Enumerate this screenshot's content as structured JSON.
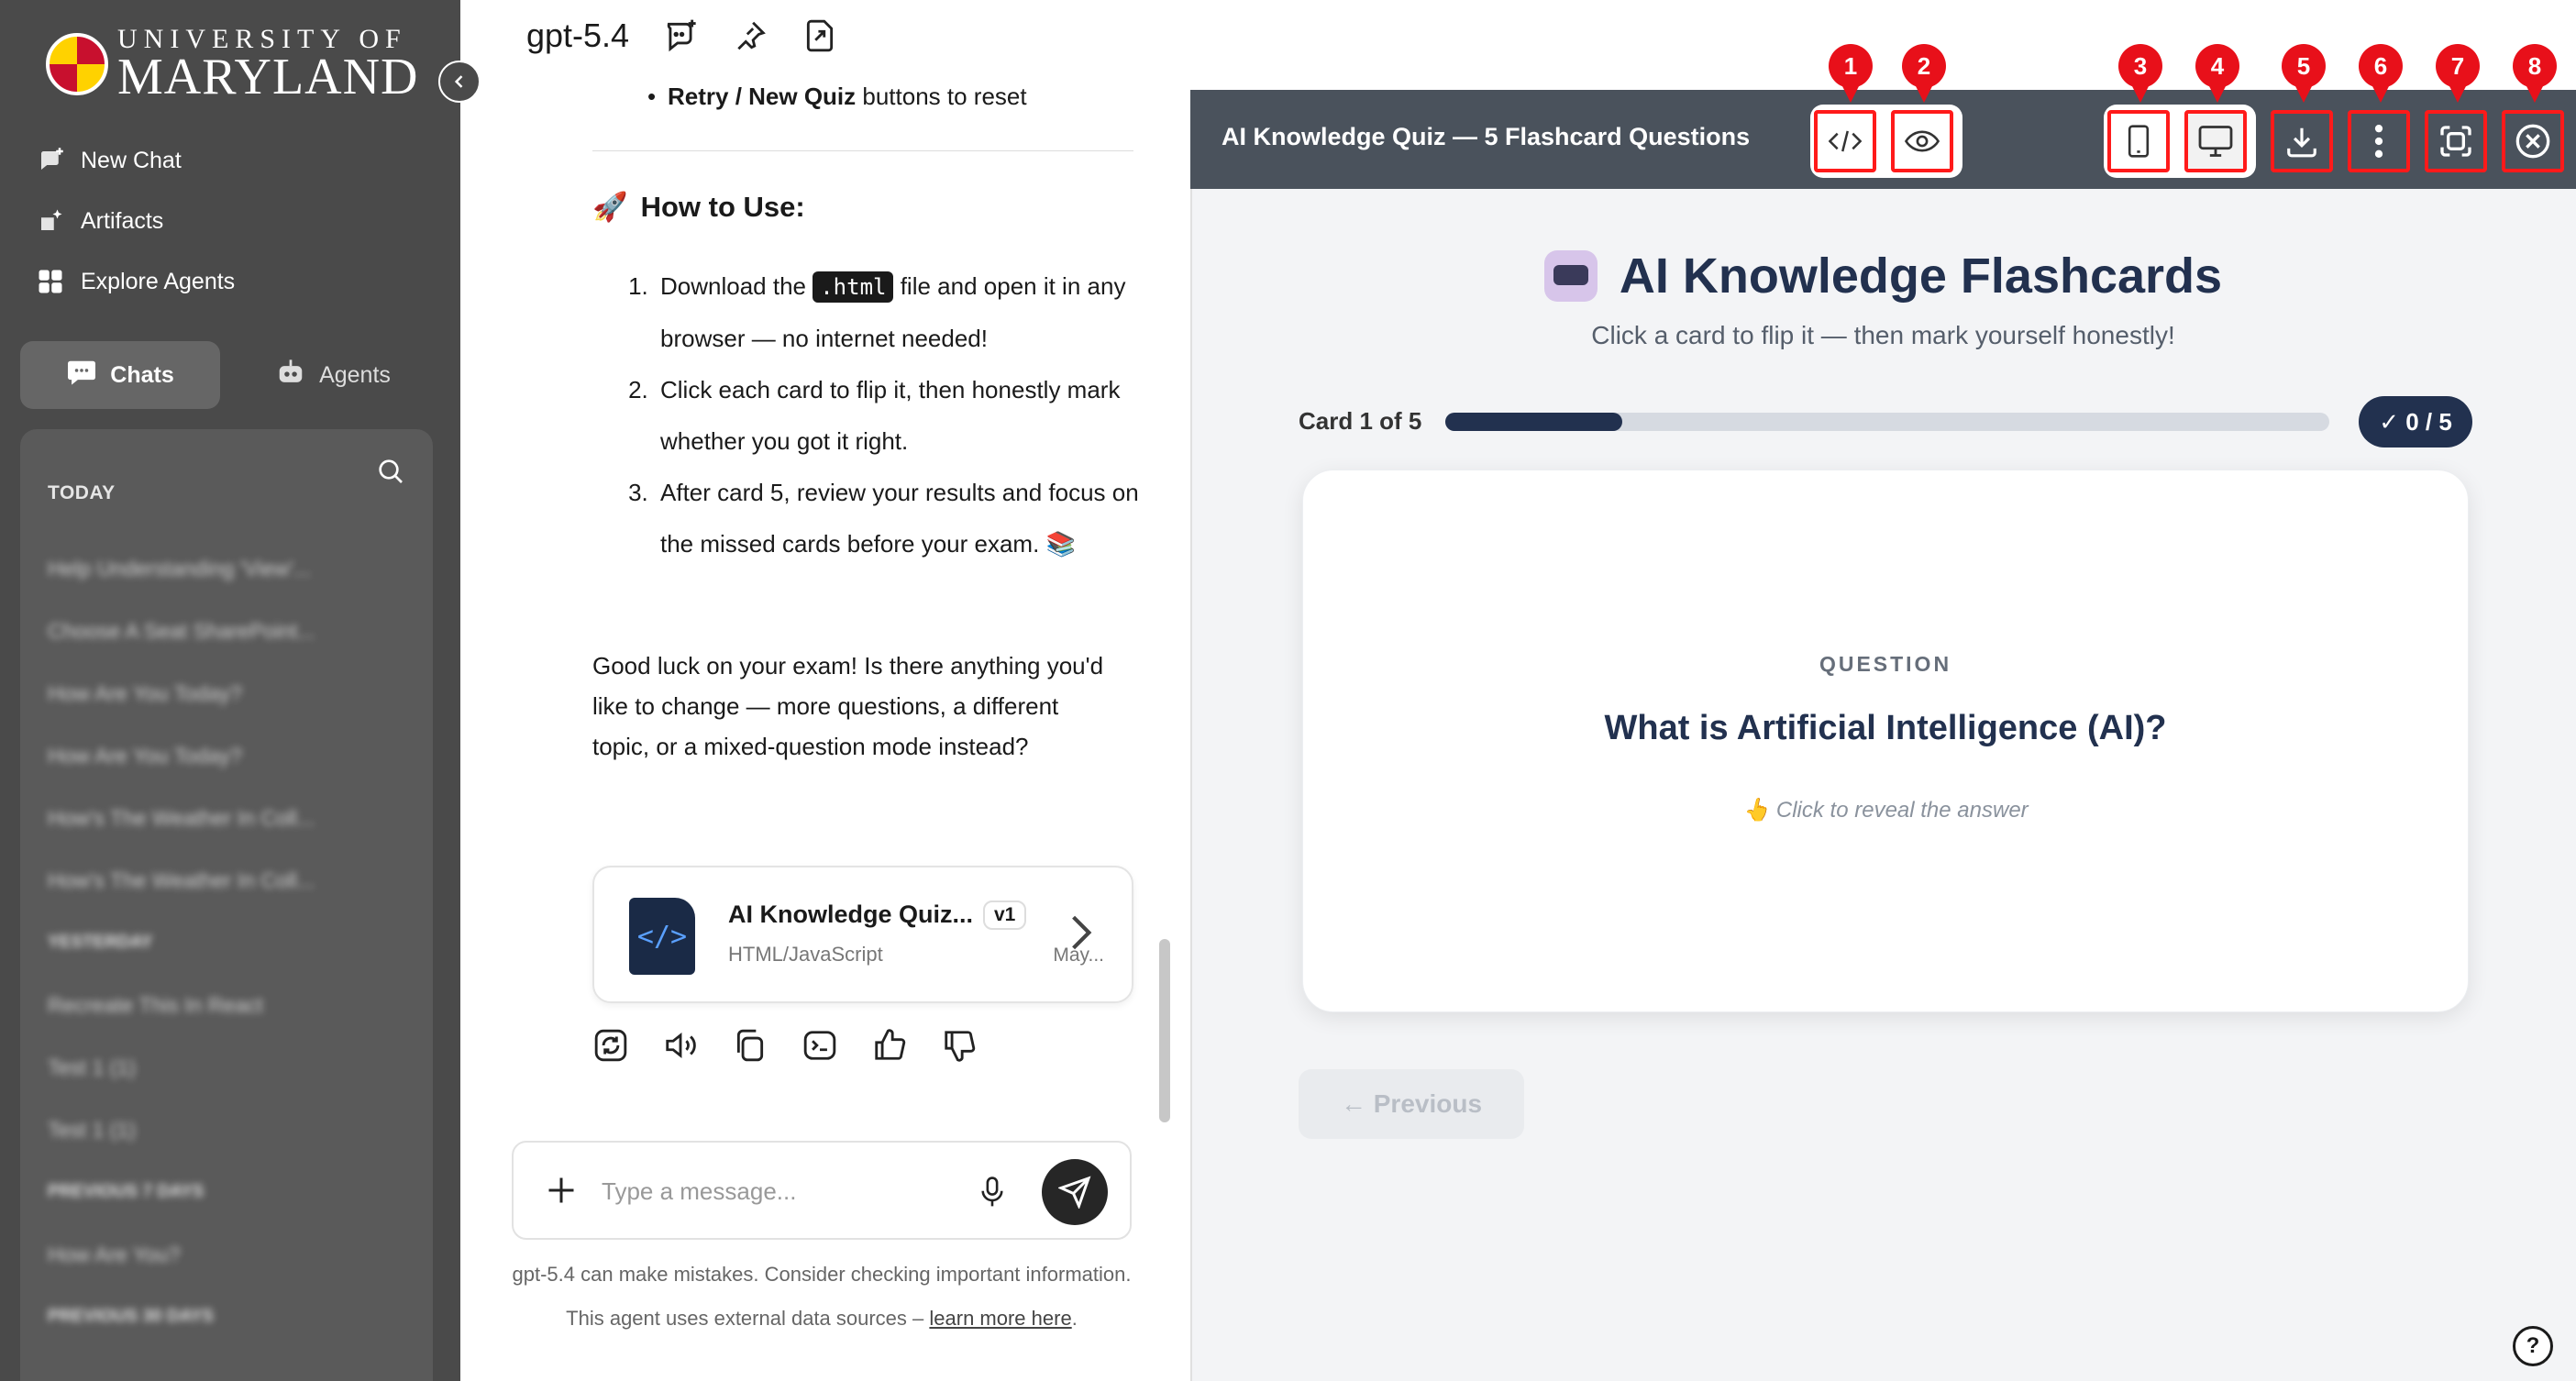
{
  "sidebar": {
    "logo": {
      "line1": "UNIVERSITY OF",
      "line2": "MARYLAND"
    },
    "nav": [
      {
        "label": "New Chat",
        "icon": "new-chat-icon"
      },
      {
        "label": "Artifacts",
        "icon": "artifacts-icon"
      },
      {
        "label": "Explore Agents",
        "icon": "grid-icon"
      }
    ],
    "tabs": {
      "chats": "Chats",
      "agents": "Agents"
    },
    "section_today": "TODAY",
    "history_blurred": [
      "Help Understanding 'View'...",
      "Choose A Seat SharePoint...",
      "How Are You Today?",
      "How Are You Today?",
      "How's The Weather In Coll...",
      "How's The Weather In Coll...",
      "YESTERDAY",
      "Recreate This In React",
      "Test 1 (1)",
      "Test 1 (1)",
      "PREVIOUS 7 DAYS",
      "How Are You?",
      "PREVIOUS 30 DAYS"
    ]
  },
  "chat": {
    "model": "gpt-5.4",
    "bullet_bold": "Retry / New Quiz",
    "bullet_rest": " buttons to reset",
    "how_to_icon": "🚀",
    "how_to": "How to Use:",
    "steps": [
      {
        "pre": "Download the ",
        "code": ".html",
        "post": " file and open it in any browser — no internet needed!"
      },
      {
        "text": "Click each card to flip it, then honestly mark whether you got it right."
      },
      {
        "text": "After card 5, review your results and focus on the missed cards before your exam. 📚"
      }
    ],
    "closing": "Good luck on your exam! Is there anything you'd like to change — more questions, a different topic, or a mixed-question mode instead?",
    "artifact": {
      "title": "AI Knowledge Quiz...",
      "version": "v1",
      "type": "HTML/JavaScript",
      "date": "May..."
    },
    "composer_placeholder": "Type a message...",
    "disclaimer": "gpt-5.4 can make mistakes. Consider checking important information. This agent uses external data sources – ",
    "learn_more": "learn more here",
    "disclaimer_end": "."
  },
  "preview": {
    "title": "AI Knowledge Quiz — 5 Flashcard Questions",
    "markers": [
      "1",
      "2",
      "3",
      "4",
      "5",
      "6",
      "7",
      "8"
    ],
    "flashcards_title": "AI Knowledge Flashcards",
    "subtitle": "Click a card to flip it — then mark yourself honestly!",
    "progress_label": "Card 1 of 5",
    "progress_fraction": 0.2,
    "score": "✓ 0 / 5",
    "card": {
      "kicker": "QUESTION",
      "question": "What is Artificial Intelligence (AI)?",
      "hint": "👆 Click to reveal the answer"
    },
    "prev_button": "← Previous",
    "help": "?"
  },
  "colors": {
    "sidebar": "#4a4a4a",
    "accent_navy": "#22314f",
    "marker_red": "#e8101a",
    "preview_bar": "#4a525c"
  }
}
